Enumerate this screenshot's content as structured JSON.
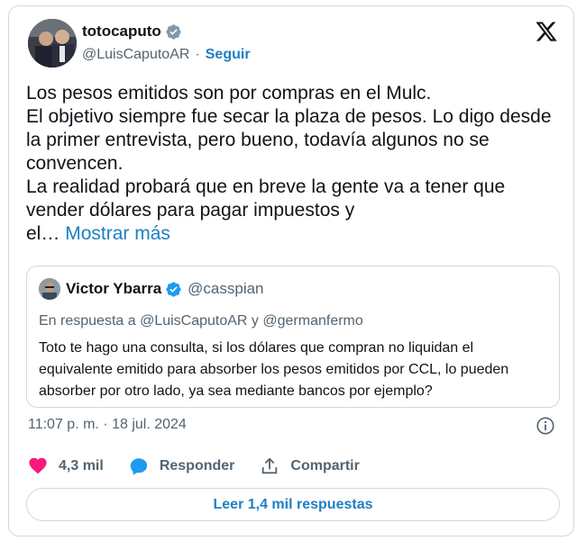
{
  "author": {
    "display_name": "totocaputo",
    "handle": "@LuisCaputoAR",
    "separator": "·",
    "follow_label": "Seguir",
    "verified_color": "#829aab"
  },
  "tweet": {
    "text": "Los pesos emitidos son por compras en el Mulc.\nEl objetivo siempre fue secar la plaza de pesos. Lo digo desde la primer entrevista, pero bueno, todavía algunos no se convencen.\nLa realidad probará que en breve la gente va a tener que vender dólares para pagar impuestos y\nel…",
    "show_more_label": "Mostrar más",
    "timestamp": "11:07 p. m. · 18 jul. 2024"
  },
  "quoted": {
    "display_name": "Victor Ybarra",
    "handle": "@casspian",
    "reply_context": "En respuesta a @LuisCaputoAR y @germanfermo",
    "text": "Toto te hago una consulta, si los dólares que compran no liquidan el equivalente emitido para absorber los pesos emitidos por CCL, lo pueden absorber por otro lado, ya sea mediante bancos por ejemplo?",
    "verified_color": "#1d9bf0"
  },
  "actions": {
    "likes_count": "4,3 mil",
    "reply_label": "Responder",
    "share_label": "Compartir",
    "read_replies_label": "Leer 1,4 mil respuestas"
  },
  "icons": {
    "like": "heart-icon",
    "reply": "speech-bubble-icon",
    "share": "share-icon",
    "info": "info-icon",
    "logo": "x-logo-icon"
  },
  "colors": {
    "accent": "#1d7fc4",
    "heart": "#f91880",
    "bubble": "#1d9bf0"
  }
}
